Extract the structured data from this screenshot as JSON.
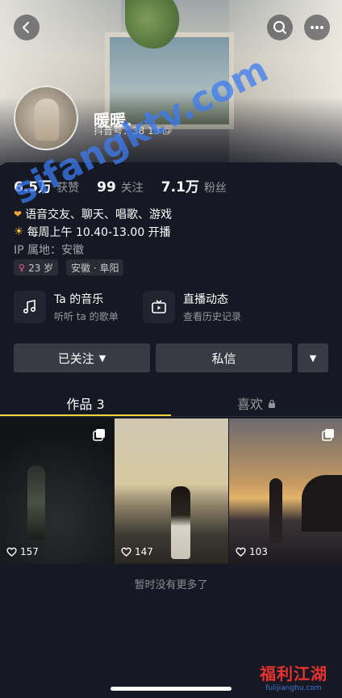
{
  "profile": {
    "name": "暖暖.",
    "douyin_id": "抖音号：38 13",
    "stats": [
      {
        "value": "6.5万",
        "label": "获赞"
      },
      {
        "value": "99",
        "label": "关注"
      },
      {
        "value": "7.1万",
        "label": "粉丝"
      }
    ],
    "bio_line1": "语音交友、聊天、唱歌、游戏",
    "bio_line2": "每周上午 10.40-13.00 开播",
    "ip": "IP 属地：安徽",
    "tags": {
      "age": "23 岁",
      "location": "安徽 · 阜阳"
    }
  },
  "entries": {
    "music": {
      "title": "Ta 的音乐",
      "sub": "听听 ta 的歌单"
    },
    "live": {
      "title": "直播动态",
      "sub": "查看历史记录"
    }
  },
  "actions": {
    "followed": "已关注",
    "message": "私信"
  },
  "tabs": {
    "works": "作品 3",
    "likes": "喜欢"
  },
  "videos": [
    {
      "likes": "157"
    },
    {
      "likes": "147"
    },
    {
      "likes": "103"
    }
  ],
  "no_more": "暂时没有更多了",
  "watermark": {
    "site": "sifangktv.com",
    "logo": "福利江湖",
    "logo_sub": "fulijianghu.com"
  },
  "colors": {
    "accent": "#f7d335",
    "background": "#161823",
    "button": "#393b44",
    "watermark_blue": "#3c7cf0"
  },
  "icons": [
    "back-icon",
    "search-icon",
    "more-icon",
    "copy-icon",
    "female-icon",
    "music-icon",
    "live-tv-icon",
    "dropdown-icon",
    "lock-icon",
    "heart-icon",
    "multi-image-icon"
  ]
}
